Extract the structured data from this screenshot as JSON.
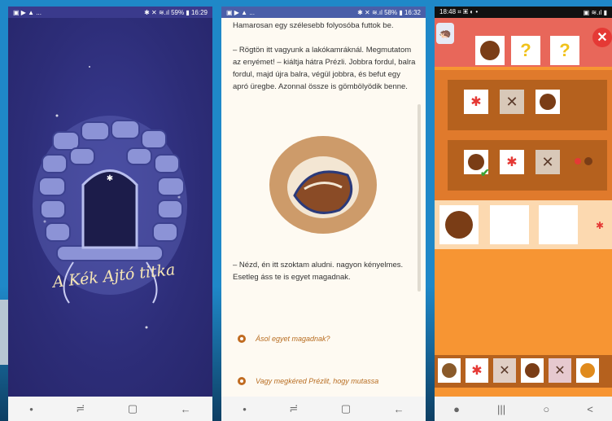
{
  "phone1": {
    "status": {
      "left_icons": "▣ ▶ ▲ ...",
      "right": "✱ ✕ ≋.ıl 59% ▮ 16:29"
    },
    "title": "A Kék Ajtó titka",
    "nav": {
      "recent": "≓",
      "home": "▢",
      "back": "←"
    }
  },
  "phone2": {
    "status": {
      "left_icons": "▣ ▶ ▲ ...",
      "right": "✱ ✕ ≋.ıl 58% ▮ 16:32"
    },
    "story_top": "Hamarosan egy szélesebb folyosóba futtok be.",
    "story_p2": "– Rögtön itt vagyunk a lakókamráknál. Megmutatom az enyémet! – kiáltja hátra Prézli. Jobbra fordul, balra fordul, majd újra balra, végül jobbra, és befut egy apró üregbe. Azonnal össze is gömbölyödik benne.",
    "story_p3": "– Nézd, én itt szoktam aludni. nagyon kényelmes. Esetleg áss te is egyet magadnak.",
    "choices": [
      "Ásol egyet magadnak?",
      "Vagy megkéred Prézlit, hogy mutassa"
    ],
    "nav": {
      "recent": "≓",
      "home": "▢",
      "back": "←"
    }
  },
  "phone3": {
    "status": {
      "left": "18:48 ⌗ ▣ ◐ •",
      "right": "▣ ≋.ıl ▮"
    },
    "question_mark": "?",
    "nav": {
      "recent": "|||",
      "home": "○",
      "back": "<"
    }
  },
  "colors": {
    "accent_orange": "#f79533",
    "row_brown": "#b5611e",
    "night_blue": "#2e2f7a"
  }
}
